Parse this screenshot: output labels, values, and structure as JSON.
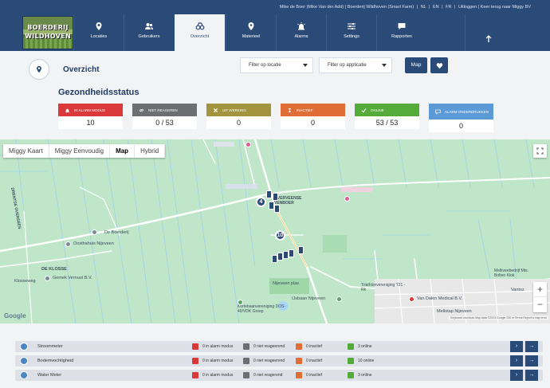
{
  "app": {
    "logo_line1": "BOERDERIJ",
    "logo_line2": "WILDHOVEN",
    "top_links": {
      "user": "Mike de Boer (Mike Van der Add) | Boerderij Wildhoven (Smart Farm)",
      "lang_nl": "NL",
      "lang_en": "EN",
      "lang_fr": "FR",
      "logout": "Uitloggen | Keer terug naar Miggy BV"
    }
  },
  "nav": [
    {
      "label": "Locaties",
      "icon": "location-pin-icon"
    },
    {
      "label": "Gebruikers",
      "icon": "users-icon"
    },
    {
      "label": "Overzicht",
      "icon": "binoculars-icon",
      "active": true
    },
    {
      "label": "Materieel",
      "icon": "equipment-pin-icon"
    },
    {
      "label": "Alarms",
      "icon": "alarm-icon"
    },
    {
      "label": "Settings",
      "icon": "sliders-icon"
    },
    {
      "label": "Rapporten",
      "icon": "chat-icon"
    }
  ],
  "header": {
    "title": "Overzicht",
    "filter_location": "Filter op locatie",
    "filter_application": "Filter op applicatie",
    "map_button": "Map",
    "section_title": "Gezondheidsstatus"
  },
  "stats": [
    {
      "label": "In alarm modus",
      "value": "10",
      "color": "#d9393a",
      "icon": "alarm-bell-icon"
    },
    {
      "label": "Niet reageren",
      "value": "0 / 53",
      "color": "#6d6e72",
      "icon": "broken-link-icon"
    },
    {
      "label": "Uit werking",
      "value": "0",
      "color": "#a2953e",
      "icon": "x-mark-icon"
    },
    {
      "label": "Inactief",
      "value": "0",
      "color": "#e06d36",
      "icon": "hourglass-icon"
    },
    {
      "label": "Online",
      "value": "53 / 53",
      "color": "#55ab3a",
      "icon": "check-icon"
    },
    {
      "label": "Alarm onderdrukken",
      "value": "0",
      "color": "#5b9ad6",
      "icon": "chat-bubble-icon"
    }
  ],
  "map": {
    "types": [
      "Miggy Kaart",
      "Miggy Eenvoudig",
      "Map",
      "Hybrid"
    ],
    "selected_type": "Map",
    "labels": {
      "boerderij": "De Boerderij",
      "oosthahuis": "Oosthahuis Nijeveen",
      "gemek": "Gemek Vernuut B.V.",
      "deklosse": "DE KLOSSE",
      "klosseweg": "Klosseweg",
      "overveense": "OVERVEENSE VENBOER",
      "nijeveen_plas": "Nijeveen plas",
      "ijsbaan": "IJsbaan Nijeveen",
      "kortebaan": "Kortebaanvereniging DOS-40/VDK Groep",
      "triathlon": "Triathlonvereniging T21 - Rk",
      "vandalen": "Van Dalen Medical B.V.",
      "melkveebedrijf": "Melkveebedrijf Mts. Bolten Klok",
      "vantoz": "Vantoz",
      "mellotap": "Mellotap Nijeveen",
      "drentse": "DRENTSE OVERSEES",
      "attribution": "Keyboard shortcuts   Map data ©2023 Google   200 m   Terms   Report a map error",
      "google": "Google"
    },
    "clusters": [
      "4",
      "10"
    ]
  },
  "devices": [
    {
      "name": "Stroommeter",
      "alarm": "0 in alarm modus",
      "noresp": "0 niet reageerend",
      "inactive": "0 inactief",
      "online": "3 online"
    },
    {
      "name": "Bodemvochtigheid",
      "alarm": "0 in alarm modus",
      "noresp": "0 niet reageerend",
      "inactive": "0 inactief",
      "online": "10 online"
    },
    {
      "name": "Water Meter",
      "alarm": "0 in alarm modus",
      "noresp": "0 niet reagerend",
      "inactive": "0 inactief",
      "online": "3 online"
    }
  ],
  "colors": {
    "primary": "#2a4a78",
    "alarm": "#d9393a",
    "noresp": "#6d6e72",
    "inactive": "#e06d36",
    "online": "#55ab3a"
  }
}
